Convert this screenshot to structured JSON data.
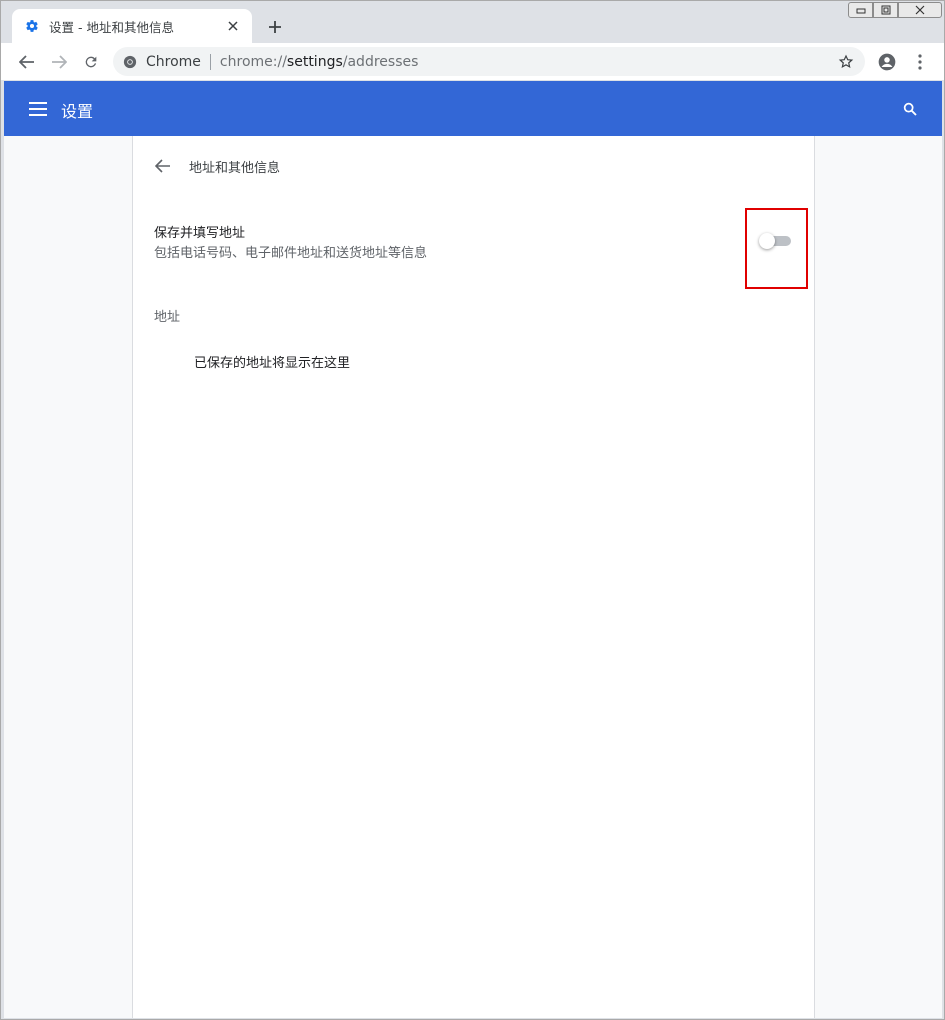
{
  "window": {
    "controls": {
      "minimize_icon": "minimize-icon",
      "restore_icon": "restore-icon",
      "close_icon": "close-icon"
    }
  },
  "tab": {
    "title": "设置 - 地址和其他信息",
    "favicon": "gear-icon"
  },
  "toolbar": {
    "omnibox_label": "Chrome",
    "url_scheme": "chrome://",
    "url_host": "settings",
    "url_path": "/addresses"
  },
  "header": {
    "title": "设置"
  },
  "subpage": {
    "title": "地址和其他信息"
  },
  "autofill_row": {
    "title": "保存并填写地址",
    "subtitle": "包括电话号码、电子邮件地址和送货地址等信息",
    "toggle_on": false
  },
  "addresses_section": {
    "label": "地址",
    "empty_message": "已保存的地址将显示在这里"
  },
  "colors": {
    "header_bg": "#3367d6",
    "highlight": "#e00000",
    "accent": "#1a73e8"
  }
}
